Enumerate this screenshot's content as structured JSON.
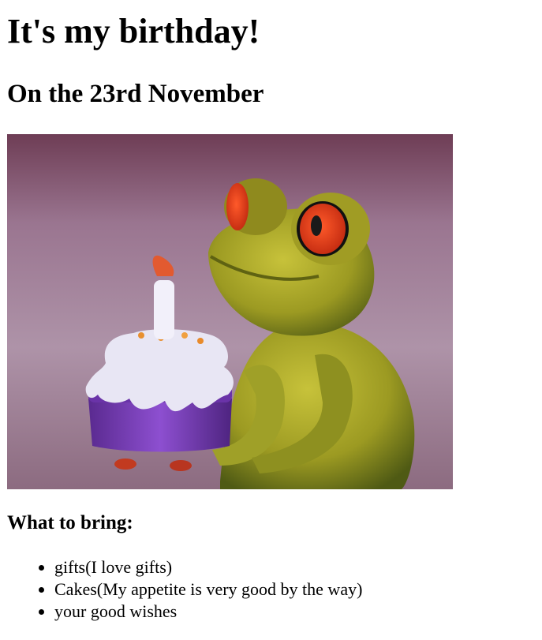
{
  "page": {
    "title": "It's my birthday!",
    "subtitle": "On the 23rd November",
    "bring_heading": "What to bring:",
    "bring_items": [
      "gifts(I love gifts)",
      "Cakes(My appetite is very good by the way)",
      "your good wishes"
    ]
  },
  "photo": {
    "subject": "frog-figurine-holding-birthday-cake",
    "colors": {
      "background": "#a88a9e",
      "frog": "#a8a22a",
      "eye": "#e8401a",
      "cake_base": "#7a3fb8",
      "frosting": "#e6e4f2"
    }
  }
}
